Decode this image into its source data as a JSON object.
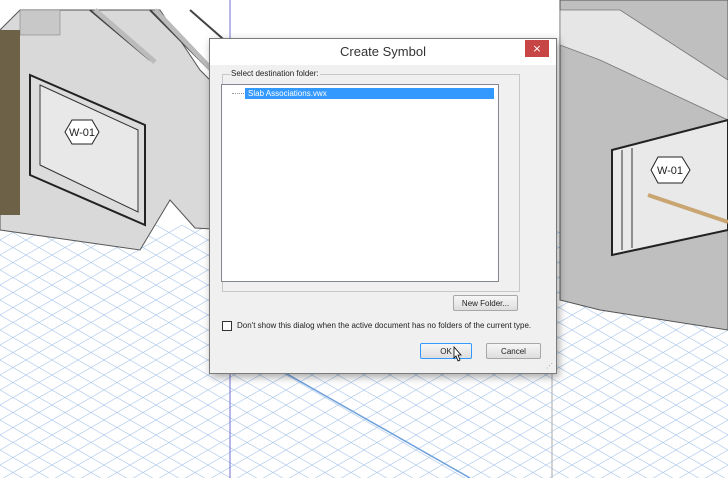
{
  "scene": {
    "wall_tag_left": "W-01",
    "wall_tag_right": "W-01"
  },
  "dialog": {
    "title": "Create Symbol",
    "close_glyph": "×",
    "group_label": "Select destination folder:",
    "tree_items": [
      "Slab Associations.vwx"
    ],
    "new_folder_label": "New Folder...",
    "checkbox_label": "Don't show this dialog when the active document has no folders of the current type.",
    "checkbox_checked": false,
    "ok_label": "OK",
    "cancel_label": "Cancel"
  },
  "colors": {
    "selection": "#3399ff",
    "close_button": "#c74545"
  }
}
